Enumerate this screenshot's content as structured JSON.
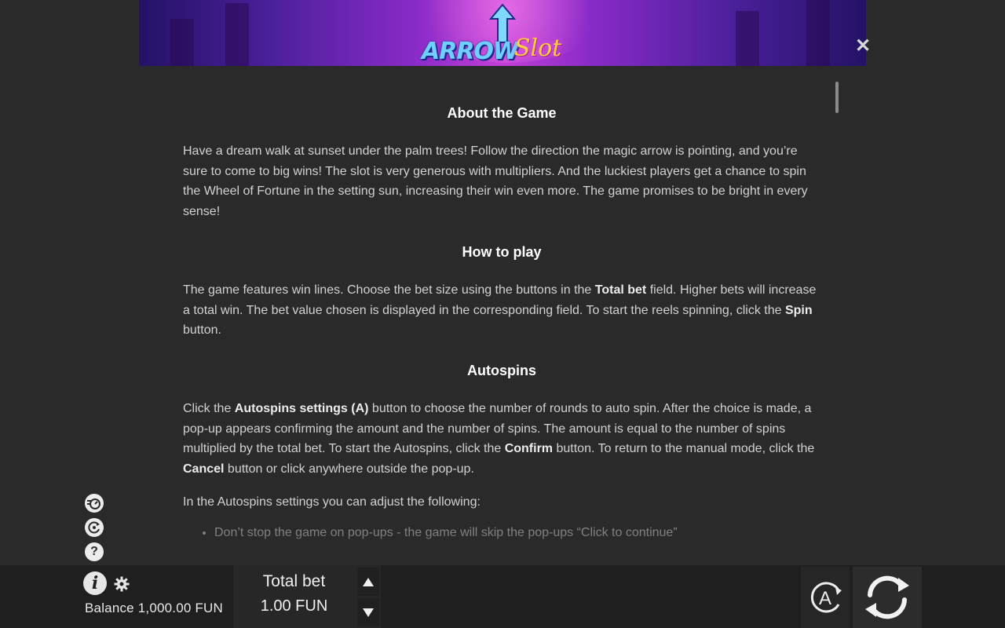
{
  "banner": {
    "logo_part1": "ARROW",
    "logo_part2": "Slot"
  },
  "dialog": {
    "close_symbol": "✕",
    "sections": {
      "about": {
        "title": "About the Game",
        "text": "Have a dream walk at sunset under the palm trees! Follow the direction the magic arrow is pointing, and you’re sure to come to big wins! The slot is very generous with multipliers. And the luckiest players get a chance to spin the Wheel of Fortune in the setting sun, increasing their win even more. The game promises to be bright in every sense!"
      },
      "how_to_play": {
        "title": "How to play",
        "text_1": "The game features win lines. Choose the bet size using the buttons in the ",
        "bold_1": "Total bet",
        "text_2": " field. Higher bets will increase a total win. The bet value chosen is displayed in the corresponding field. To start the reels spinning, click the ",
        "bold_2": "Spin",
        "text_3": " button."
      },
      "autospins": {
        "title": "Autospins",
        "text_1": "Click the ",
        "bold_1": "Autospins settings (A)",
        "text_2": " button to choose the number of rounds to auto spin. After the choice is made, a pop-up appears confirming the amount and the number of spins. The amount is equal to the number of spins multiplied by the total bet. To start the Autospins, click the ",
        "bold_2": "Confirm",
        "text_3": " button. To return to the manual mode, click the ",
        "bold_3": "Cancel",
        "text_4": " button or click anywhere outside the pop-up.",
        "settings_intro": "In the Autospins settings you can adjust the following:",
        "settings_items": [
          "Don’t stop the game on pop-ups - the game will skip the pop-ups “Click to continue”"
        ]
      }
    }
  },
  "side_icons": [
    "turbo-icon",
    "autoplay-icon",
    "help-icon"
  ],
  "side_icon_glyphs": {
    "help": "?"
  },
  "bottom_bar": {
    "info_glyph": "i",
    "balance": "Balance 1,000.00 FUN",
    "total_bet_label": "Total bet",
    "total_bet_value": "1.00 FUN",
    "autospin_glyph": "A"
  },
  "colors": {
    "background": "#2a2a2a",
    "bottom_bar": "#1f1f1f",
    "heading": "#ffffff",
    "body_text": "#d2d2d2"
  }
}
